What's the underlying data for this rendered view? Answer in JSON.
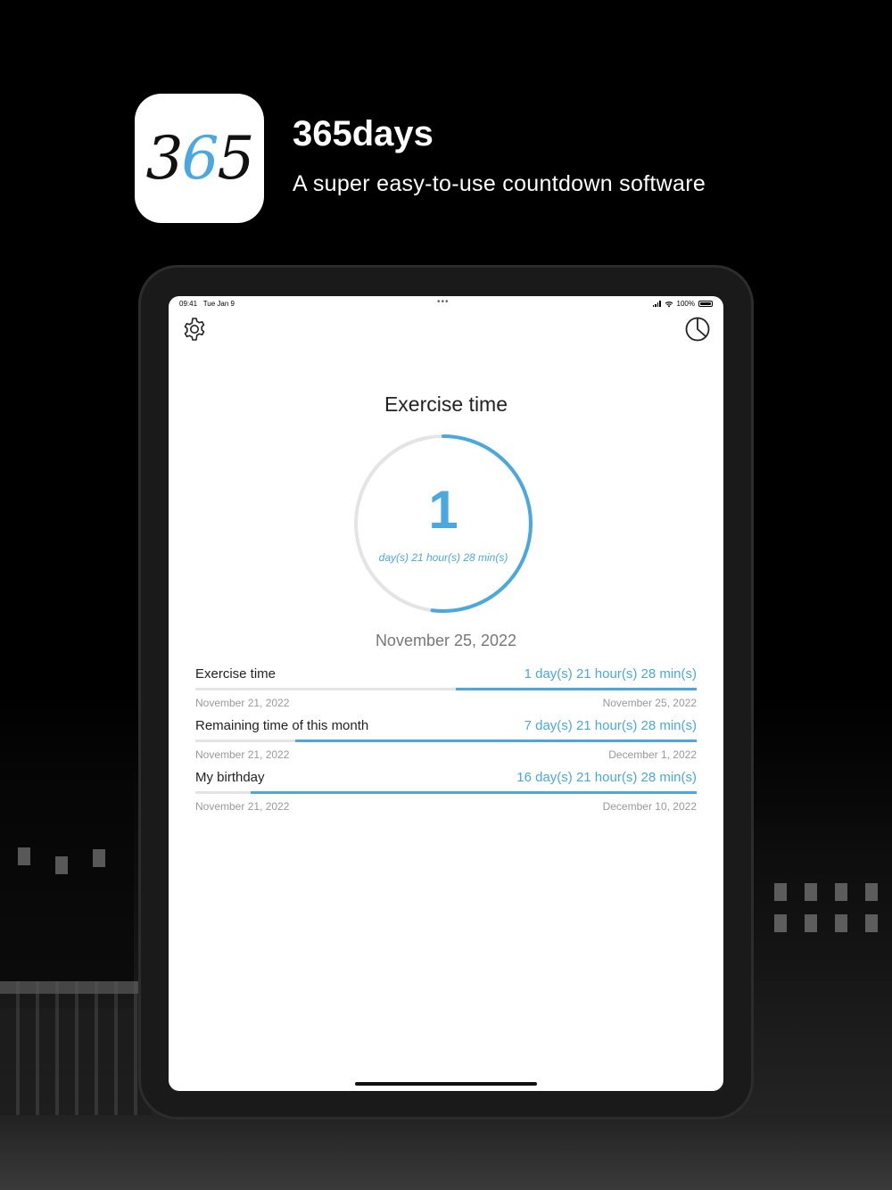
{
  "header": {
    "icon_digits": [
      "3",
      "6",
      "5"
    ],
    "title": "365days",
    "subtitle": "A super easy-to-use countdown software"
  },
  "status_bar": {
    "time": "09:41",
    "date": "Tue Jan 9",
    "battery": "100%"
  },
  "toolbar": {
    "left_icon": "gear-icon",
    "right_icon": "pie-chart-icon"
  },
  "main": {
    "title": "Exercise time",
    "count": "1",
    "remaining_detail": "day(s) 21 hour(s) 28 min(s)",
    "progress": 0.52,
    "target_date": "November 25, 2022"
  },
  "items": [
    {
      "name": "Exercise time",
      "remaining": "1 day(s) 21 hour(s) 28 min(s)",
      "start": "November 21, 2022",
      "end": "November 25, 2022",
      "remaining_fraction": 0.48
    },
    {
      "name": "Remaining time of this month",
      "remaining": "7 day(s) 21 hour(s) 28 min(s)",
      "start": "November 21, 2022",
      "end": "December 1, 2022",
      "remaining_fraction": 0.8
    },
    {
      "name": "My birthday",
      "remaining": "16 day(s) 21 hour(s) 28 min(s)",
      "start": "November 21, 2022",
      "end": "December 10, 2022",
      "remaining_fraction": 0.89
    }
  ],
  "colors": {
    "accent": "#4aa8e0",
    "track": "#e4e4e4"
  }
}
